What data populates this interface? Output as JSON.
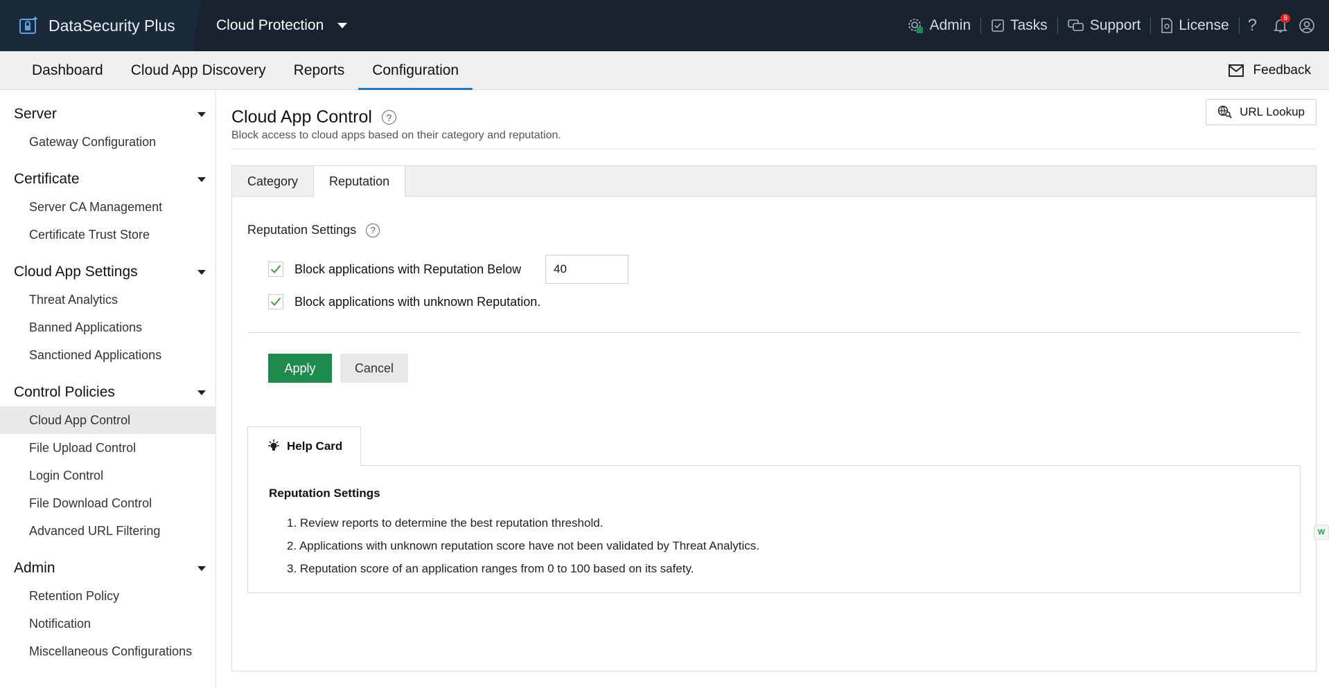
{
  "header": {
    "brand": "DataSecurity Plus",
    "product": "Cloud Protection",
    "links": [
      {
        "label": "Admin",
        "icon": "admin-gear-icon"
      },
      {
        "label": "Tasks",
        "icon": "tasks-icon"
      },
      {
        "label": "Support",
        "icon": "support-chat-icon"
      },
      {
        "label": "License",
        "icon": "license-icon"
      }
    ],
    "help": "?",
    "notification_count": "8",
    "colors": {
      "topbar": "#18232f",
      "accent": "#1f77c6",
      "apply": "#1e8a4c"
    }
  },
  "nav": {
    "tabs": [
      "Dashboard",
      "Cloud App Discovery",
      "Reports",
      "Configuration"
    ],
    "active_tab": "Configuration",
    "feedback": "Feedback"
  },
  "sidebar": {
    "groups": [
      {
        "title": "Server",
        "items": [
          "Gateway Configuration"
        ]
      },
      {
        "title": "Certificate",
        "items": [
          "Server CA Management",
          "Certificate Trust Store"
        ]
      },
      {
        "title": "Cloud App Settings",
        "items": [
          "Threat Analytics",
          "Banned Applications",
          "Sanctioned Applications"
        ]
      },
      {
        "title": "Control Policies",
        "items": [
          "Cloud App Control",
          "File Upload Control",
          "Login Control",
          "File Download Control",
          "Advanced URL Filtering"
        ]
      },
      {
        "title": "Admin",
        "items": [
          "Retention Policy",
          "Notification",
          "Miscellaneous Configurations"
        ]
      }
    ],
    "active_item": "Cloud App Control"
  },
  "page": {
    "title": "Cloud App Control",
    "subtitle": "Block access to cloud apps based on their category and reputation.",
    "url_lookup": "URL Lookup",
    "tabs": [
      "Category",
      "Reputation"
    ],
    "active_tab": "Reputation"
  },
  "reputation": {
    "section_title": "Reputation Settings",
    "block_below_label": "Block applications with Reputation Below",
    "block_below_checked": true,
    "block_below_value": "40",
    "block_unknown_label": "Block applications with unknown Reputation.",
    "block_unknown_checked": true,
    "apply": "Apply",
    "cancel": "Cancel"
  },
  "help_card": {
    "tab_label": "Help Card",
    "heading": "Reputation Settings",
    "items": [
      "1. Review reports to determine the best reputation threshold.",
      "2. Applications with unknown reputation score have not been validated by Threat Analytics.",
      "3. Reputation score of an application ranges from 0 to 100 based on its safety."
    ]
  },
  "edge_badge": "W"
}
